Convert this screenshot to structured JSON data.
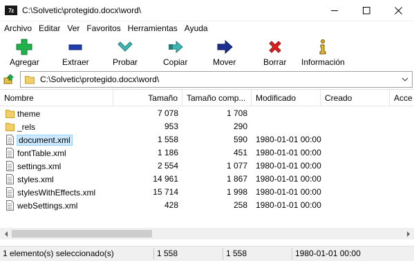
{
  "window": {
    "app_icon_text": "7z",
    "title": "C:\\Solvetic\\protegido.docx\\word\\"
  },
  "menu": {
    "items": [
      "Archivo",
      "Editar",
      "Ver",
      "Favoritos",
      "Herramientas",
      "Ayuda"
    ]
  },
  "toolbar": {
    "add": "Agregar",
    "extract": "Extraer",
    "test": "Probar",
    "copy": "Copiar",
    "move": "Mover",
    "delete": "Borrar",
    "info": "Información"
  },
  "address": {
    "path": "C:\\Solvetic\\protegido.docx\\word\\"
  },
  "columns": {
    "name": "Nombre",
    "size": "Tamaño",
    "packed": "Tamaño comp...",
    "modified": "Modificado",
    "created": "Creado",
    "accessed": "Acce"
  },
  "files": [
    {
      "name": "theme",
      "size": "7 078",
      "packed": "1 708",
      "modified": "",
      "type": "folder"
    },
    {
      "name": "_rels",
      "size": "953",
      "packed": "290",
      "modified": "",
      "type": "folder"
    },
    {
      "name": "document.xml",
      "size": "1 558",
      "packed": "590",
      "modified": "1980-01-01 00:00",
      "type": "file",
      "selected": true
    },
    {
      "name": "fontTable.xml",
      "size": "1 186",
      "packed": "451",
      "modified": "1980-01-01 00:00",
      "type": "file"
    },
    {
      "name": "settings.xml",
      "size": "2 554",
      "packed": "1 077",
      "modified": "1980-01-01 00:00",
      "type": "file"
    },
    {
      "name": "styles.xml",
      "size": "14 961",
      "packed": "1 867",
      "modified": "1980-01-01 00:00",
      "type": "file"
    },
    {
      "name": "stylesWithEffects.xml",
      "size": "15 714",
      "packed": "1 998",
      "modified": "1980-01-01 00:00",
      "type": "file"
    },
    {
      "name": "webSettings.xml",
      "size": "428",
      "packed": "258",
      "modified": "1980-01-01 00:00",
      "type": "file"
    }
  ],
  "status": {
    "selection": "1 elemento(s) seleccionado(s)",
    "size": "1 558",
    "packed": "1 558",
    "modified": "1980-01-01 00:00"
  },
  "colors": {
    "selection_bg": "#cce8ff",
    "folder": "#f3cf6a",
    "add_green": "#22b24c",
    "extract_blue": "#1f3fb0",
    "test_teal": "#3fb6b4",
    "move_navy": "#1c2f8f",
    "delete_red": "#e02020"
  }
}
